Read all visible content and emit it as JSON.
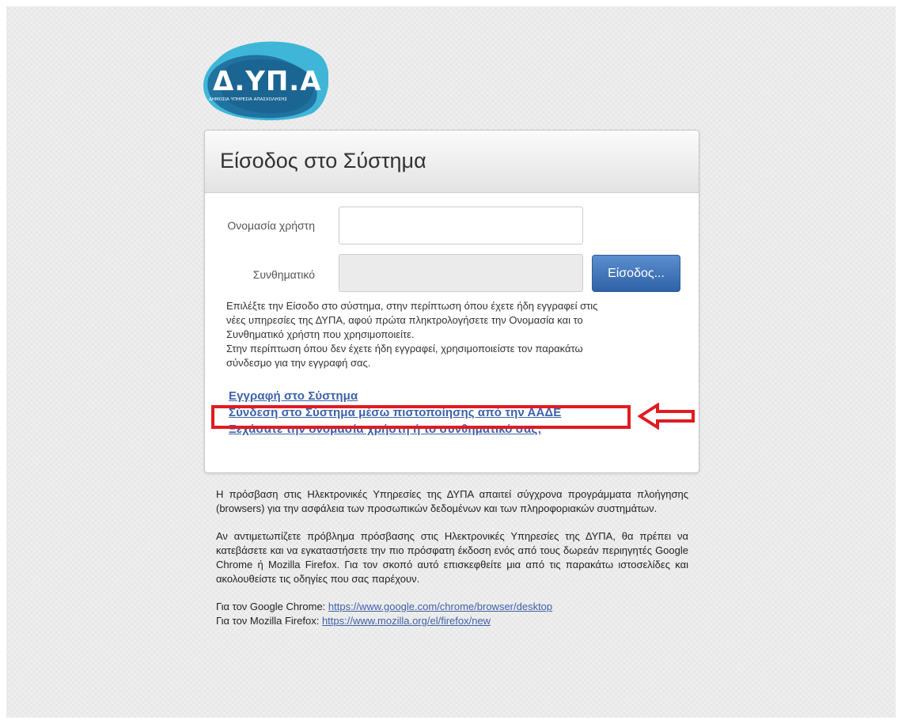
{
  "logo": {
    "text": "Δ.ΥΠ.Α",
    "tagline": "ΔΗΜΟΣΙΑ ΥΠΗΡΕΣΙΑ ΑΠΑΣΧΟΛΗΣΗΣ",
    "colors": {
      "dark": "#1f6f9e",
      "light": "#3fb6d8",
      "accent": "#f7941d"
    }
  },
  "login": {
    "title": "Είσοδος στο Σύστημα",
    "username_label": "Ονομασία χρήστη",
    "username_value": "",
    "password_label": "Συνθηματικό",
    "password_value": "",
    "submit_label": "Είσοδος...",
    "help_lines": [
      "Επιλέξτε την Είσοδο στο σύστημα, στην περίπτωση όπου έχετε ήδη εγγραφεί στις",
      "νέες υπηρεσίες της ΔΥΠΑ, αφού πρώτα πληκτρολογήσετε την Ονομασία και το",
      "Συνθηματικό χρήστη που χρησιμοποιείτε.",
      "Στην περίπτωση όπου δεν έχετε ήδη εγγραφεί, χρησιμοποιείστε τον παρακάτω",
      "σύνδεσμο για την εγγραφή σας."
    ],
    "links": {
      "register": "Εγγραφή στο Σύστημα",
      "aade": "Σύνδεση στο Σύστημα μέσω πιστοποίησης από την ΑΑΔΕ",
      "forgot": "Ξεχάσατε την ονομασία χρήστη ή το συνθηματικό σας;"
    }
  },
  "annotation": {
    "color": "#e01b22"
  },
  "footer": {
    "para1": "Η πρόσβαση στις Ηλεκτρονικές Υπηρεσίες της ΔΥΠΑ απαιτεί σύγχρονα προγράμματα πλοήγησης (browsers) για την ασφάλεια των προσωπικών δεδομένων και των πληροφοριακών συστημάτων.",
    "para2": "Αν αντιμετωπίζετε πρόβλημα πρόσβασης στις Ηλεκτρονικές Υπηρεσίες της ΔΥΠΑ, θα πρέπει να κατεβάσετε και να εγκαταστήσετε την πιο πρόσφατη έκδοση ενός από τους δωρεάν περιηγητές Google Chrome ή Mozilla Firefox. Για τον σκοπό αυτό επισκεφθείτε μια από τις παρακάτω ιστοσελίδες και ακολουθείστε τις οδηγίες που σας παρέχουν.",
    "chrome_label": "Για τον Google Chrome: ",
    "chrome_url": "https://www.google.com/chrome/browser/desktop",
    "firefox_label": "Για τον Mozilla Firefox: ",
    "firefox_url": "https://www.mozilla.org/el/firefox/new"
  }
}
